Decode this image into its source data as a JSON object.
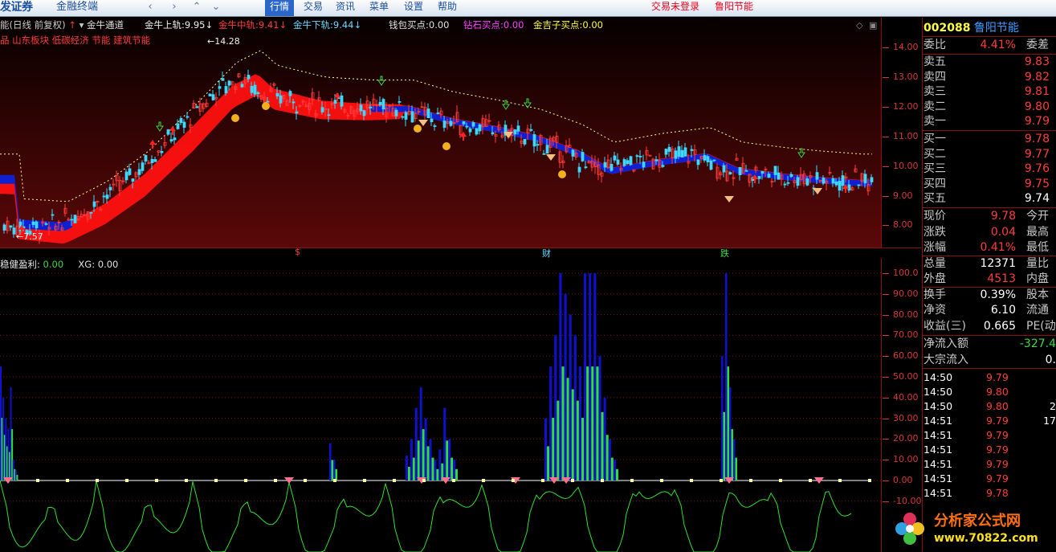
{
  "menubar": {
    "logo": "发证券",
    "app_title": "金融终端",
    "nav_buttons": [
      "‹",
      "›",
      "⌃",
      "⌄"
    ],
    "menus": [
      "行情",
      "交易",
      "资讯",
      "菜单",
      "设置",
      "帮助"
    ],
    "active_menu": "行情",
    "status_links": [
      "交易未登录",
      "鲁阳节能"
    ]
  },
  "top_panel": {
    "title": "能(日线 前复权)",
    "indicator_name": "金牛通道",
    "upper_label": "金牛上轨:",
    "upper_value": "9.95",
    "middle_label": "金牛中轨:",
    "middle_value": "9.41",
    "lower_label": "金牛下轨:",
    "lower_value": "9.44",
    "wallet_label": "钱包买点:",
    "wallet_value": "0.00",
    "diamond_label": "钻石买点:",
    "diamond_value": "0.00",
    "ingot_label": "金吉子买点:",
    "ingot_value": "0.00",
    "sector_tags": "品 山东板块 低碳经济 节能 建筑节能",
    "high_marker": "14.28",
    "low_marker": "7.57",
    "y_ticks": [
      "14.00",
      "13.00",
      "12.00",
      "11.00",
      "10.00",
      "9.00",
      "8.00"
    ],
    "event_markers": [
      "$",
      "财",
      "跌"
    ]
  },
  "bottom_panel": {
    "title": "稳健盈利",
    "title_value": "0.00",
    "xg_label": "XG:",
    "xg_value": "0.00",
    "y_ticks": [
      "100.0",
      "90.00",
      "80.00",
      "70.00",
      "60.00",
      "50.00",
      "40.00",
      "30.00",
      "20.00",
      "10.00",
      "0.00",
      "-10.00"
    ]
  },
  "quote": {
    "code": "002088",
    "name": "鲁阳节能",
    "webi_label": "委比",
    "webi_value": "4.41%",
    "webi_diff_label": "委差",
    "asks": [
      {
        "label": "卖五",
        "price": "9.83"
      },
      {
        "label": "卖四",
        "price": "9.82"
      },
      {
        "label": "卖三",
        "price": "9.81"
      },
      {
        "label": "卖二",
        "price": "9.80"
      },
      {
        "label": "卖一",
        "price": "9.79"
      }
    ],
    "bids": [
      {
        "label": "买一",
        "price": "9.78"
      },
      {
        "label": "买二",
        "price": "9.77"
      },
      {
        "label": "买三",
        "price": "9.76"
      },
      {
        "label": "买四",
        "price": "9.75"
      },
      {
        "label": "买五",
        "price": "9.74"
      }
    ],
    "stats": [
      {
        "label": "现价",
        "value": "9.78",
        "right": "今开"
      },
      {
        "label": "涨跌",
        "value": "0.04",
        "right": "最高"
      },
      {
        "label": "涨幅",
        "value": "0.41%",
        "right": "最低"
      },
      {
        "label": "总量",
        "value": "12371",
        "right": "量比"
      },
      {
        "label": "外盘",
        "value": "4513",
        "right": "内盘"
      },
      {
        "label": "换手",
        "value": "0.39%",
        "right": "股本"
      },
      {
        "label": "净资",
        "value": "6.10",
        "right": "流通"
      },
      {
        "label": "收益(三)",
        "value": "0.665",
        "right": "PE(动)"
      }
    ],
    "net_inflow_label": "净流入额",
    "net_inflow_value": "-327.4",
    "big_inflow_label": "大宗流入",
    "big_inflow_value": "0.",
    "ticks": [
      {
        "time": "14:50",
        "price": "9.79",
        "vol": ""
      },
      {
        "time": "14:50",
        "price": "9.80",
        "vol": ""
      },
      {
        "time": "14:50",
        "price": "9.80",
        "vol": "2"
      },
      {
        "time": "14:51",
        "price": "9.79",
        "vol": "17"
      },
      {
        "time": "14:51",
        "price": "9.79",
        "vol": ""
      },
      {
        "time": "14:51",
        "price": "9.79",
        "vol": ""
      },
      {
        "time": "14:51",
        "price": "9.79",
        "vol": ""
      },
      {
        "time": "14:51",
        "price": "9.79",
        "vol": ""
      },
      {
        "time": "14:51",
        "price": "9.78",
        "vol": ""
      }
    ]
  },
  "watermark": {
    "line1": "分析家公式网",
    "line2": "www.70822.com"
  },
  "colors": {
    "up": "#ff3c3c",
    "down": "#3cd8ff",
    "channel_red": "#ff1010",
    "channel_blue": "#1020d0",
    "osc_blue": "#1010d0",
    "osc_green": "#30e030"
  }
}
